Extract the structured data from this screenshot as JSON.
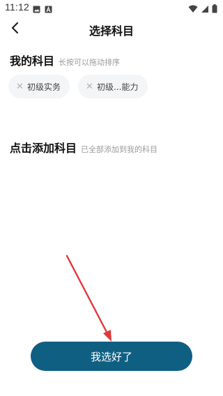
{
  "status_bar": {
    "time": "11:12",
    "left_icons": [
      "image-icon",
      "text-a-icon"
    ],
    "right_icons": [
      "wifi-icon",
      "signal-icon",
      "battery-icon"
    ]
  },
  "header": {
    "title": "选择科目",
    "back_icon": "chevron-left-icon"
  },
  "my_subjects": {
    "title": "我的科目",
    "hint": "长按可以拖动排序",
    "items": [
      {
        "label": "初级实务"
      },
      {
        "label": "初级...能力"
      }
    ]
  },
  "add_subjects": {
    "title": "点击添加科目",
    "hint": "已全部添加到我的科目"
  },
  "confirm_button": {
    "label": "我选好了",
    "color": "#0f5f83"
  },
  "annotation": {
    "arrow_color": "#e0393c"
  }
}
